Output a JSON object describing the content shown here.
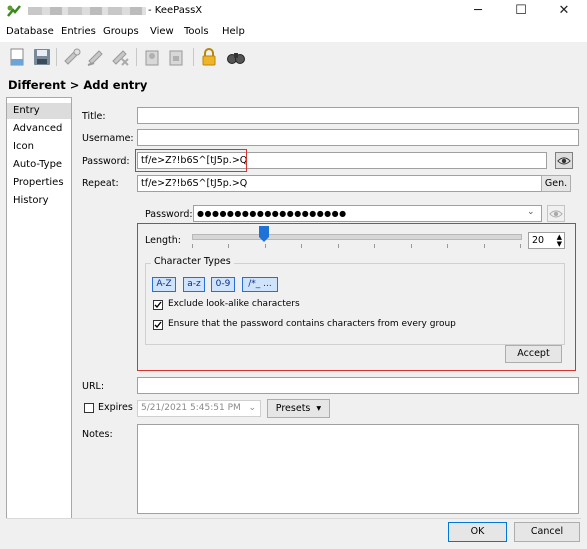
{
  "window": {
    "title": "- KeePassX",
    "minimize_glyph": "─",
    "maximize_glyph": "☐",
    "close_glyph": "✕"
  },
  "menu": [
    "Database",
    "Entries",
    "Groups",
    "View",
    "Tools",
    "Help"
  ],
  "toolbar_icons": [
    "new-database-icon",
    "save-database-icon",
    "add-entry-icon",
    "edit-entry-icon",
    "delete-entry-icon",
    "copy-username-icon",
    "copy-password-icon",
    "lock-database-icon",
    "search-icon"
  ],
  "heading": "Different > Add entry",
  "sidebar": [
    "Entry",
    "Advanced",
    "Icon",
    "Auto-Type",
    "Properties",
    "History"
  ],
  "form": {
    "title_label": "Title:",
    "title_value": "",
    "username_label": "Username:",
    "username_value": "",
    "password_label": "Password:",
    "password_value": "tf/e>Z?!b6S^[tJ5p.>Q",
    "repeat_label": "Repeat:",
    "repeat_value": "tf/e>Z?!b6S^[tJ5p.>Q",
    "gen_button": "Gen.",
    "url_label": "URL:",
    "url_value": "",
    "expires_label": "Expires",
    "expires_value": "5/21/2021 5:45:51 PM",
    "presets_button": "Presets",
    "notes_label": "Notes:"
  },
  "generator": {
    "password_label": "Password:",
    "password_masked": "●●●●●●●●●●●●●●●●●●●●",
    "length_label": "Length:",
    "length_value": "20",
    "length_fraction": 0.22,
    "char_types_label": "Character Types",
    "char_types": [
      "A-Z",
      "a-z",
      "0-9",
      "/*_ ..."
    ],
    "exclude_lookalike": "Exclude look-alike characters",
    "every_group": "Ensure that the password contains characters from every group",
    "accept_button": "Accept"
  },
  "footer": {
    "ok_button": "OK",
    "cancel_button": "Cancel"
  },
  "colors": {
    "highlight_red": "#d9342b",
    "char_type_blue": "#2a6fd6",
    "slider_blue": "#1f73d6"
  }
}
